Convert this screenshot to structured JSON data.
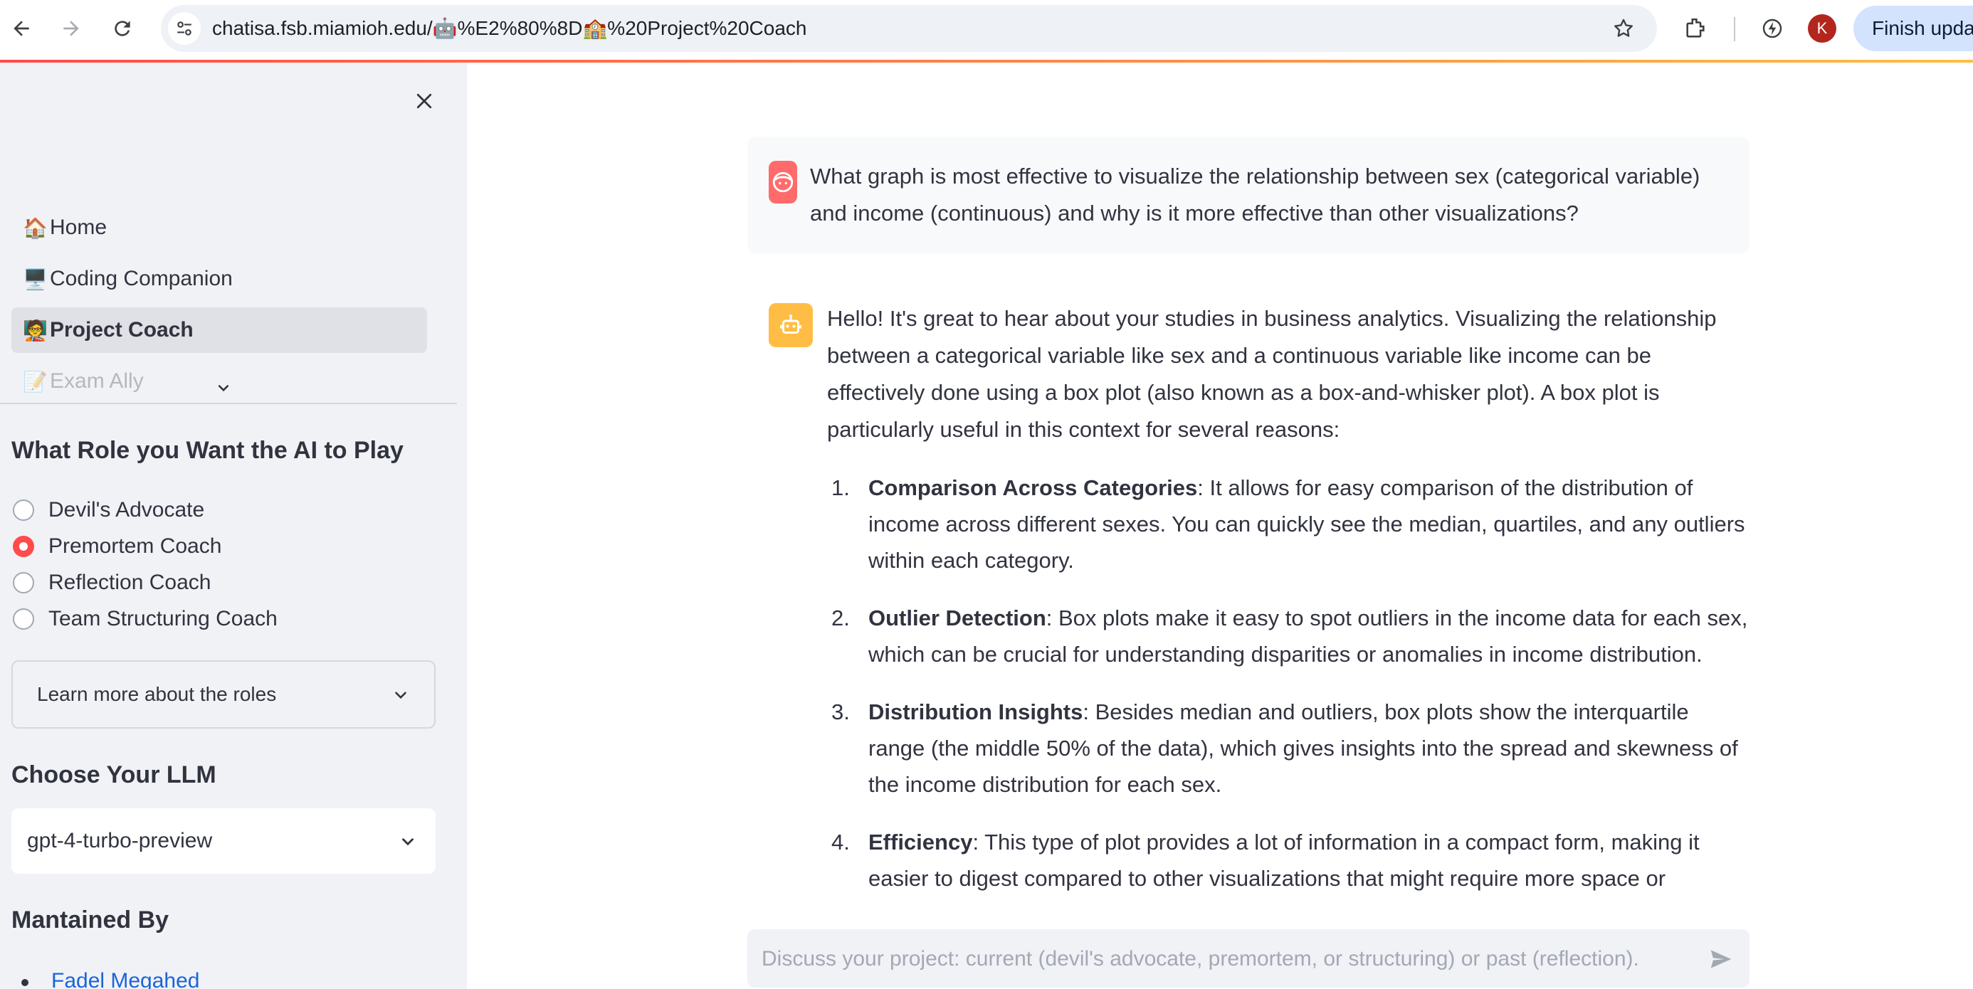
{
  "browser": {
    "url": "chatisa.fsb.miamioh.edu/🤖%E2%80%8D🏫%20Project%20Coach",
    "profile_initial": "K",
    "update_button": "Finish upda",
    "accent": "#ff4b4b"
  },
  "sidebar": {
    "nav": [
      {
        "icon": "🏠",
        "label": "Home"
      },
      {
        "icon": "🖥️",
        "label": "Coding Companion"
      },
      {
        "icon": "🧑‍🏫",
        "label": "Project Coach"
      },
      {
        "icon": "📝",
        "label": "Exam Ally"
      }
    ],
    "active_nav": "Project Coach",
    "role_heading": "What Role you Want the AI to Play",
    "roles": [
      "Devil's Advocate",
      "Premortem Coach",
      "Reflection Coach",
      "Team Structuring Coach"
    ],
    "selected_role": "Premortem Coach",
    "roles_expander": "Learn more about the roles",
    "llm_heading": "Choose Your LLM",
    "llm_value": "gpt-4-turbo-preview",
    "maintained_heading": "Mantained By",
    "maintainers": [
      "Fadel Megahed"
    ]
  },
  "chat": {
    "user_message": "What graph is most effective to visualize the relationship between sex (categorical variable) and income (continuous) and why is it more effective than other visualizations?",
    "assistant_intro": "Hello! It's great to hear about your studies in business analytics. Visualizing the relationship between a categorical variable like sex and a continuous variable like income can be effectively done using a box plot (also known as a box-and-whisker plot). A box plot is particularly useful in this context for several reasons:",
    "assistant_points": [
      {
        "num": "1.",
        "title": "Comparison Across Categories",
        "text": ": It allows for easy comparison of the distribution of income across different sexes. You can quickly see the median, quartiles, and any outliers within each category."
      },
      {
        "num": "2.",
        "title": "Outlier Detection",
        "text": ": Box plots make it easy to spot outliers in the income data for each sex, which can be crucial for understanding disparities or anomalies in income distribution."
      },
      {
        "num": "3.",
        "title": "Distribution Insights",
        "text": ": Besides median and outliers, box plots show the interquartile range (the middle 50% of the data), which gives insights into the spread and skewness of the income distribution for each sex."
      },
      {
        "num": "4.",
        "title": "Efficiency",
        "text": ": This type of plot provides a lot of information in a compact form, making it easier to digest compared to other visualizations that might require more space or complexity to"
      }
    ],
    "input_placeholder": "Discuss your project: current (devil's advocate, premortem, or structuring) or past (reflection)."
  }
}
